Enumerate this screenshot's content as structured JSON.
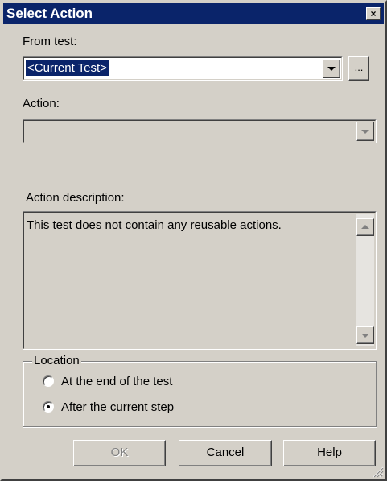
{
  "window": {
    "title": "Select Action",
    "close_glyph": "×"
  },
  "from_test": {
    "label": "From test:",
    "value": "<Current Test>",
    "browse_label": "..."
  },
  "action": {
    "label": "Action:",
    "value": ""
  },
  "description": {
    "label": "Action description:",
    "text": "This test does not contain any reusable actions."
  },
  "location": {
    "legend": "Location",
    "options": [
      {
        "label": "At the end of the test",
        "selected": false
      },
      {
        "label": "After the current step",
        "selected": true
      }
    ]
  },
  "buttons": {
    "ok": "OK",
    "cancel": "Cancel",
    "help": "Help"
  },
  "colors": {
    "titlebar": "#0a246a",
    "face": "#d4d0c8",
    "highlight": "#0a246a"
  }
}
